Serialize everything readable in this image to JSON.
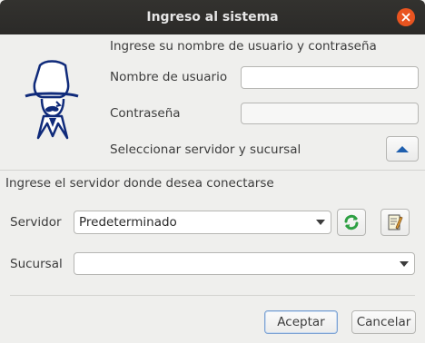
{
  "window": {
    "title": "Ingreso al sistema"
  },
  "login": {
    "prompt": "Ingrese su nombre de usuario y contraseña",
    "username_label": "Nombre de usuario",
    "username_value": "",
    "password_label": "Contraseña",
    "password_value": "",
    "server_toggle_label": "Seleccionar servidor y sucursal"
  },
  "server": {
    "prompt": "Ingrese el servidor donde desea conectarse",
    "servidor_label": "Servidor",
    "servidor_value": "Predeterminado",
    "sucursal_label": "Sucursal",
    "sucursal_value": ""
  },
  "buttons": {
    "accept": "Aceptar",
    "cancel": "Cancelar"
  },
  "icons": {
    "close": "close-icon",
    "logo": "gaucho-figure-icon",
    "toggle": "chevron-up-icon",
    "refresh": "refresh-icon",
    "edit": "edit-document-icon",
    "dropdown": "chevron-down-icon"
  },
  "colors": {
    "titlebar": "#2f2e2b",
    "close": "#e95420",
    "accent": "#1f5fae",
    "refresh_green": "#2ea043"
  }
}
